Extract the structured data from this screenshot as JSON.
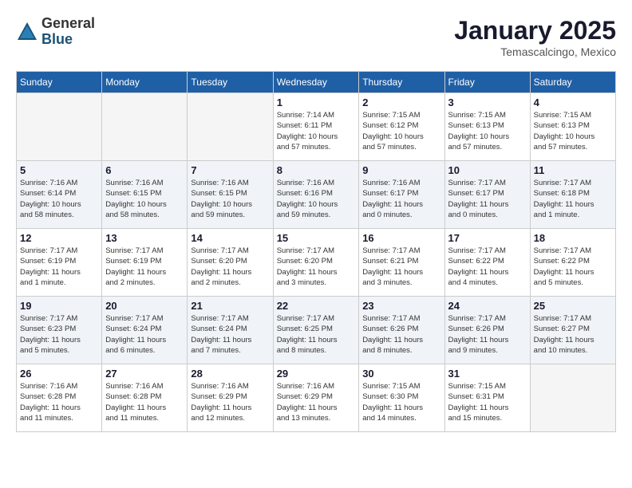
{
  "logo": {
    "general": "General",
    "blue": "Blue"
  },
  "title": "January 2025",
  "location": "Temascalcingo, Mexico",
  "weekdays": [
    "Sunday",
    "Monday",
    "Tuesday",
    "Wednesday",
    "Thursday",
    "Friday",
    "Saturday"
  ],
  "weeks": [
    [
      {
        "day": "",
        "info": ""
      },
      {
        "day": "",
        "info": ""
      },
      {
        "day": "",
        "info": ""
      },
      {
        "day": "1",
        "info": "Sunrise: 7:14 AM\nSunset: 6:11 PM\nDaylight: 10 hours\nand 57 minutes."
      },
      {
        "day": "2",
        "info": "Sunrise: 7:15 AM\nSunset: 6:12 PM\nDaylight: 10 hours\nand 57 minutes."
      },
      {
        "day": "3",
        "info": "Sunrise: 7:15 AM\nSunset: 6:13 PM\nDaylight: 10 hours\nand 57 minutes."
      },
      {
        "day": "4",
        "info": "Sunrise: 7:15 AM\nSunset: 6:13 PM\nDaylight: 10 hours\nand 57 minutes."
      }
    ],
    [
      {
        "day": "5",
        "info": "Sunrise: 7:16 AM\nSunset: 6:14 PM\nDaylight: 10 hours\nand 58 minutes."
      },
      {
        "day": "6",
        "info": "Sunrise: 7:16 AM\nSunset: 6:15 PM\nDaylight: 10 hours\nand 58 minutes."
      },
      {
        "day": "7",
        "info": "Sunrise: 7:16 AM\nSunset: 6:15 PM\nDaylight: 10 hours\nand 59 minutes."
      },
      {
        "day": "8",
        "info": "Sunrise: 7:16 AM\nSunset: 6:16 PM\nDaylight: 10 hours\nand 59 minutes."
      },
      {
        "day": "9",
        "info": "Sunrise: 7:16 AM\nSunset: 6:17 PM\nDaylight: 11 hours\nand 0 minutes."
      },
      {
        "day": "10",
        "info": "Sunrise: 7:17 AM\nSunset: 6:17 PM\nDaylight: 11 hours\nand 0 minutes."
      },
      {
        "day": "11",
        "info": "Sunrise: 7:17 AM\nSunset: 6:18 PM\nDaylight: 11 hours\nand 1 minute."
      }
    ],
    [
      {
        "day": "12",
        "info": "Sunrise: 7:17 AM\nSunset: 6:19 PM\nDaylight: 11 hours\nand 1 minute."
      },
      {
        "day": "13",
        "info": "Sunrise: 7:17 AM\nSunset: 6:19 PM\nDaylight: 11 hours\nand 2 minutes."
      },
      {
        "day": "14",
        "info": "Sunrise: 7:17 AM\nSunset: 6:20 PM\nDaylight: 11 hours\nand 2 minutes."
      },
      {
        "day": "15",
        "info": "Sunrise: 7:17 AM\nSunset: 6:20 PM\nDaylight: 11 hours\nand 3 minutes."
      },
      {
        "day": "16",
        "info": "Sunrise: 7:17 AM\nSunset: 6:21 PM\nDaylight: 11 hours\nand 3 minutes."
      },
      {
        "day": "17",
        "info": "Sunrise: 7:17 AM\nSunset: 6:22 PM\nDaylight: 11 hours\nand 4 minutes."
      },
      {
        "day": "18",
        "info": "Sunrise: 7:17 AM\nSunset: 6:22 PM\nDaylight: 11 hours\nand 5 minutes."
      }
    ],
    [
      {
        "day": "19",
        "info": "Sunrise: 7:17 AM\nSunset: 6:23 PM\nDaylight: 11 hours\nand 5 minutes."
      },
      {
        "day": "20",
        "info": "Sunrise: 7:17 AM\nSunset: 6:24 PM\nDaylight: 11 hours\nand 6 minutes."
      },
      {
        "day": "21",
        "info": "Sunrise: 7:17 AM\nSunset: 6:24 PM\nDaylight: 11 hours\nand 7 minutes."
      },
      {
        "day": "22",
        "info": "Sunrise: 7:17 AM\nSunset: 6:25 PM\nDaylight: 11 hours\nand 8 minutes."
      },
      {
        "day": "23",
        "info": "Sunrise: 7:17 AM\nSunset: 6:26 PM\nDaylight: 11 hours\nand 8 minutes."
      },
      {
        "day": "24",
        "info": "Sunrise: 7:17 AM\nSunset: 6:26 PM\nDaylight: 11 hours\nand 9 minutes."
      },
      {
        "day": "25",
        "info": "Sunrise: 7:17 AM\nSunset: 6:27 PM\nDaylight: 11 hours\nand 10 minutes."
      }
    ],
    [
      {
        "day": "26",
        "info": "Sunrise: 7:16 AM\nSunset: 6:28 PM\nDaylight: 11 hours\nand 11 minutes."
      },
      {
        "day": "27",
        "info": "Sunrise: 7:16 AM\nSunset: 6:28 PM\nDaylight: 11 hours\nand 11 minutes."
      },
      {
        "day": "28",
        "info": "Sunrise: 7:16 AM\nSunset: 6:29 PM\nDaylight: 11 hours\nand 12 minutes."
      },
      {
        "day": "29",
        "info": "Sunrise: 7:16 AM\nSunset: 6:29 PM\nDaylight: 11 hours\nand 13 minutes."
      },
      {
        "day": "30",
        "info": "Sunrise: 7:15 AM\nSunset: 6:30 PM\nDaylight: 11 hours\nand 14 minutes."
      },
      {
        "day": "31",
        "info": "Sunrise: 7:15 AM\nSunset: 6:31 PM\nDaylight: 11 hours\nand 15 minutes."
      },
      {
        "day": "",
        "info": ""
      }
    ]
  ]
}
